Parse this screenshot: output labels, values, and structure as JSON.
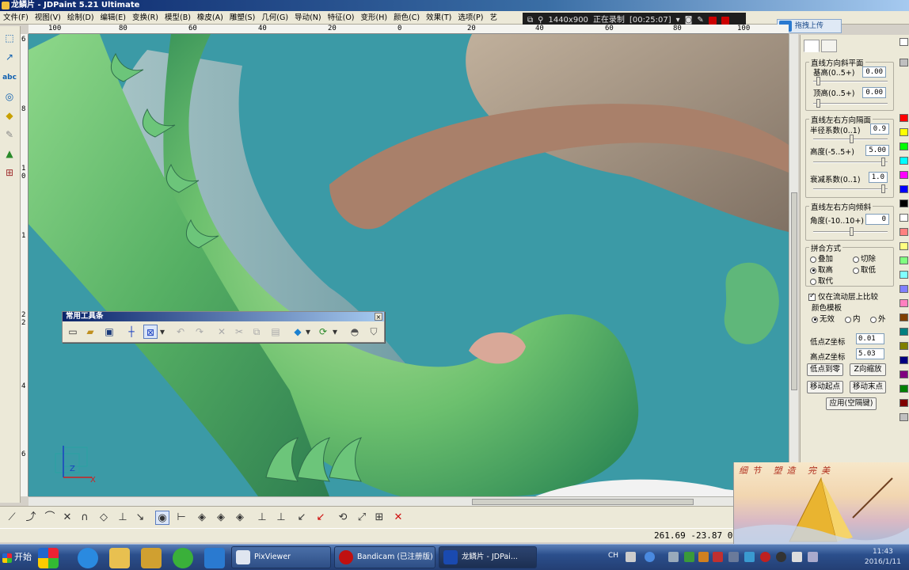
{
  "window": {
    "title": "龙鳞片 - JDPaint 5.21 Ultimate"
  },
  "menu": [
    "文件(F)",
    "视图(V)",
    "绘制(D)",
    "编辑(E)",
    "变换(R)",
    "模型(B)",
    "橡皮(A)",
    "雕塑(S)",
    "几何(G)",
    "导动(N)",
    "特征(O)",
    "变形(H)",
    "颜色(C)",
    "效果(T)",
    "选项(P)",
    "艺"
  ],
  "recorder": {
    "resolution": "1440x900",
    "status": "正在录制",
    "time": "[00:25:07]"
  },
  "upload_button": "拖拽上传",
  "ruler": {
    "top": [
      "100",
      "80",
      "60",
      "40",
      "20",
      "0",
      "20",
      "40",
      "60",
      "80",
      "100"
    ],
    "left": [
      "6",
      "8",
      "1",
      "0",
      "1",
      "2",
      "2",
      "4",
      "6"
    ]
  },
  "float_toolbar": {
    "title": "常用工具条"
  },
  "axis_gizmo": {
    "z": "Z",
    "x": "X"
  },
  "panel": {
    "group1": {
      "title": "直线方向斜平面",
      "base_label": "基高(0..5+)",
      "base_value": "0.00",
      "top_label": "顶高(0..5+)",
      "top_value": "0.00"
    },
    "group2": {
      "title": "直线左右方向隔面",
      "radius_label": "半径系数(0..1)",
      "radius_value": "0.9",
      "height_label": "高度(-5..5+)",
      "height_value": "5.00",
      "decay_label": "衰减系数(0..1)",
      "decay_value": "1.0"
    },
    "group3": {
      "title": "直线左右方向倾斜",
      "angle_label": "角度(-10..10+)",
      "angle_value": "0"
    },
    "group4": {
      "title": "拼合方式",
      "opt_add": "叠加",
      "opt_cut": "切除",
      "opt_high": "取高",
      "opt_low": "取低",
      "opt_replace": "取代"
    },
    "compare_flow": "仅在流动层上比较",
    "color_template": {
      "title": "颜色模板",
      "none": "无效",
      "inner": "内",
      "outer": "外"
    },
    "low_z_label": "低点Z坐标",
    "low_z_value": "0.01",
    "high_z_label": "高点Z坐标",
    "high_z_value": "5.03",
    "btn_low_zero": "低点到零",
    "btn_z_scale": "Z向缩放",
    "btn_move_start": "移动起点",
    "btn_move_end": "移动末点",
    "btn_apply": "应用(空隔键)"
  },
  "palette_colors": [
    "#ffffff",
    "#c0c0c0",
    "#ff0000",
    "#ffff00",
    "#00ff00",
    "#00ffff",
    "#ff00ff",
    "#0000ff",
    "#000000",
    "#ffffff",
    "#ff8080",
    "#ffff80",
    "#80ff80",
    "#80ffff",
    "#8080ff",
    "#ff80c0",
    "#804000",
    "#008080",
    "#808000",
    "#000080",
    "#800080",
    "#008000",
    "#800000",
    "#c0c0c0"
  ],
  "status": {
    "coords": "261.69 -23.87 0"
  },
  "ad": {
    "text": "细节 塑造 完美"
  },
  "taskbar": {
    "start": "开始",
    "tasks": [
      {
        "label": "PixViewer"
      },
      {
        "label": "Bandicam (已注册版)"
      },
      {
        "label": "龙鳞片 - JDPai..."
      }
    ],
    "tray_lang": "CH",
    "clock_time": "11:43",
    "clock_date": "2016/1/11"
  }
}
